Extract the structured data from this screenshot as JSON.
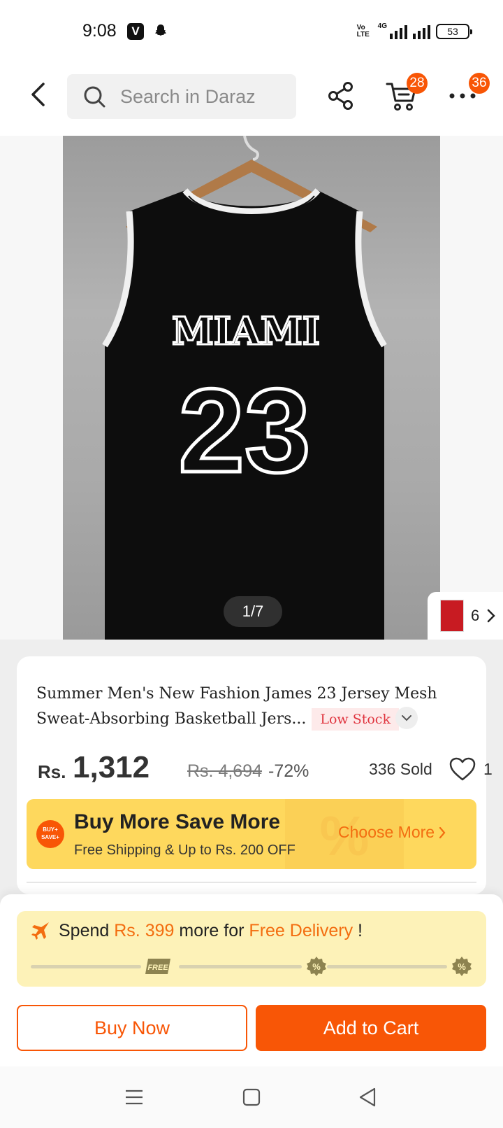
{
  "status_bar": {
    "time": "9:08",
    "network": "4G",
    "volte": "Vo LTE",
    "battery": "53"
  },
  "header": {
    "search_placeholder": "Search in Daraz",
    "cart_badge": "28",
    "more_badge": "36"
  },
  "gallery": {
    "counter": "1/7",
    "variant_count": "6",
    "jersey_text": "MIAMI",
    "jersey_number": "23"
  },
  "product": {
    "title": "Summer Men's New Fashion James 23 Jersey Mesh Sweat-Absorbing Basketball Jers...",
    "stock_label": "Low Stock",
    "currency": "Rs.",
    "price": "1,312",
    "original_price": "Rs. 4,694",
    "discount": "-72%",
    "sold": "336 Sold",
    "wishlist_count": "1"
  },
  "promo": {
    "badge_text": "BUY+ SAVE+",
    "title": "Buy More Save More",
    "subtitle": "Free Shipping & Up to Rs. 200 OFF",
    "cta": "Choose More"
  },
  "delivery": {
    "prefix": "Spend",
    "amount": "Rs. 399",
    "middle": "more for",
    "goal": "Free Delivery",
    "suffix": "!",
    "free_badge": "FREE",
    "progress": 0
  },
  "actions": {
    "buy_now": "Buy Now",
    "add_to_cart": "Add to Cart"
  },
  "colors": {
    "accent": "#f85606",
    "promo_bg": "#fed85d",
    "delivery_bg": "#fdf2b8",
    "low_stock": "#e0353f"
  },
  "icons": [
    "back-icon",
    "search-icon",
    "share-icon",
    "cart-icon",
    "more-icon",
    "heart-icon",
    "plane-icon",
    "chevron-right-icon",
    "chevron-down-icon",
    "menu-icon",
    "home-icon",
    "back-triangle-icon"
  ]
}
